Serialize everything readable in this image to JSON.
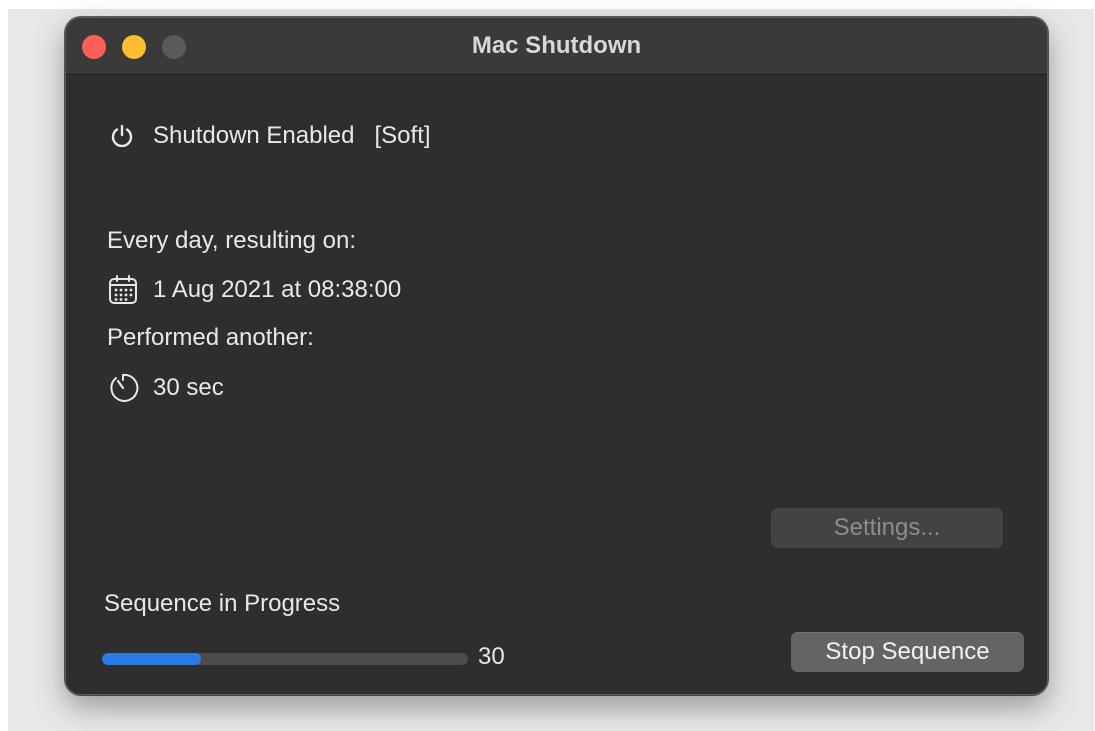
{
  "window": {
    "title": "Mac Shutdown"
  },
  "status": {
    "icon": "power-icon",
    "text": "Shutdown Enabled",
    "mode": "[Soft]"
  },
  "schedule": {
    "frequency_label": "Every day, resulting on:",
    "date_icon": "calendar-icon",
    "datetime": "1 Aug 2021 at 08:38:00",
    "delay_label": "Performed another:",
    "timer_icon": "timer-icon",
    "delay": "30 sec"
  },
  "buttons": {
    "settings_label": "Settings...",
    "stop_label": "Stop Sequence"
  },
  "progress": {
    "label": "Sequence in Progress",
    "count": "30",
    "fraction": 0.27,
    "fill_color": "#2a7ae8"
  }
}
